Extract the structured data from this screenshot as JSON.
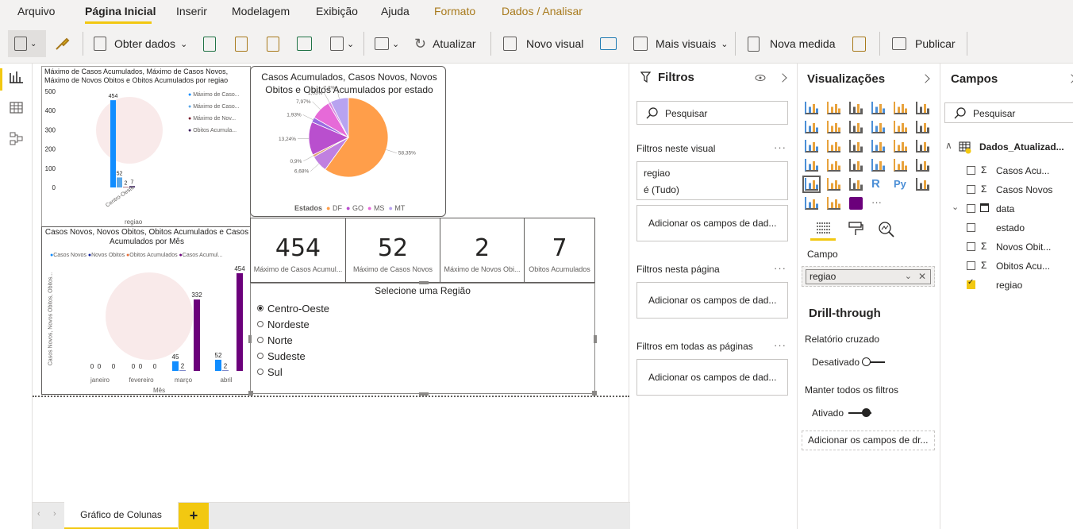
{
  "ribbon": {
    "tabs": [
      "Arquivo",
      "Página Inicial",
      "Inserir",
      "Modelagem",
      "Exibição",
      "Ajuda",
      "Formato",
      "Dados / Analisar"
    ]
  },
  "toolbar": {
    "obter": "Obter dados",
    "atualizar": "Atualizar",
    "novo_visual": "Novo visual",
    "mais_visuais": "Mais visuais",
    "nova_medida": "Nova medida",
    "publicar": "Publicar"
  },
  "colors": {
    "accent": "#f2c811",
    "bar_blue": "#118dff",
    "bar_dark": "#12239e",
    "bar_orange": "#e66c37",
    "bar_purple": "#6b007b",
    "pie_orange": "#ff9e4a",
    "pie_purple": "#b94fce",
    "pie_pink": "#e66ad8",
    "pie_lav": "#b8a3f0"
  },
  "visual1": {
    "title": "Máximo de Casos Acumulados, Máximo de Casos Novos, Máximo de Novos Obitos e Obitos Acumulados por regiao",
    "legend": [
      "Máximo de Caso...",
      "Máximo de Caso...",
      "Máximo de Nov...",
      "Obitos Acumula..."
    ],
    "xlabel": "regiao"
  },
  "visual2": {
    "title": "Casos Acumulados, Casos Novos, Novos Obitos e Obitos Acumulados por estado",
    "legend_title": "Estados",
    "legend": [
      "DF",
      "GO",
      "MS",
      "MT"
    ]
  },
  "visual3": {
    "title": "Casos Novos, Novos Obitos, Obitos Acumulados e Casos Acumulados por Mês",
    "legend": [
      "Casos Novos",
      "Novos Obitos",
      "Obitos Acumulados",
      "Casos Acumul..."
    ],
    "ylabel": "Casos Novos, Novos Obitos, Obitos...",
    "xlabel": "Mês"
  },
  "chart_data": [
    {
      "type": "bar",
      "title": "Máximo de Casos Acumulados, Máximo de Casos Novos, Máximo de Novos Obitos e Obitos Acumulados por regiao",
      "categories": [
        "Centro-Oeste"
      ],
      "series": [
        {
          "name": "Máximo de Caso...",
          "values": [
            454
          ]
        },
        {
          "name": "Máximo de Caso...",
          "values": [
            52
          ]
        },
        {
          "name": "Máximo de Nov...",
          "values": [
            2
          ]
        },
        {
          "name": "Obitos Acumula...",
          "values": [
            7
          ]
        }
      ],
      "yticks": [
        "0",
        "100",
        "200",
        "300",
        "400",
        "500"
      ],
      "ylim": [
        0,
        500
      ],
      "xlabel": "regiao",
      "legend": "right"
    },
    {
      "type": "pie",
      "title": "Casos Acumulados, Casos Novos, Novos Obitos e Obitos Acumulados por estado",
      "slices": [
        {
          "label": "58,35%",
          "value": 58.35
        },
        {
          "label": "6,68%",
          "value": 6.68
        },
        {
          "label": "0,9%",
          "value": 0.9
        },
        {
          "label": "13,24%",
          "value": 13.24
        },
        {
          "label": "1,93%",
          "value": 1.93
        },
        {
          "label": "7,97%",
          "value": 7.97
        },
        {
          "label": "1,03%",
          "value": 1.03
        },
        {
          "label": "7,2%",
          "value": 7.2
        }
      ],
      "legend": "bottom"
    },
    {
      "type": "bar",
      "title": "Casos Novos, Novos Obitos, Obitos Acumulados e Casos Acumulados por Mês",
      "categories": [
        "janeiro",
        "fevereiro",
        "março",
        "abril"
      ],
      "series": [
        {
          "name": "Casos Novos",
          "values": [
            0,
            0,
            45,
            52
          ]
        },
        {
          "name": "Novos Obitos",
          "values": [
            0,
            0,
            2,
            2
          ]
        },
        {
          "name": "Obitos Acumulados",
          "values": [
            0,
            0,
            0,
            0
          ]
        },
        {
          "name": "Casos Acumul...",
          "values": [
            0,
            0,
            332,
            454
          ]
        }
      ],
      "xlabel": "Mês",
      "ylabel": "Casos Novos, Novos Obitos, Obitos...",
      "legend": "top"
    }
  ],
  "cards": [
    {
      "value": "454",
      "label": "Máximo de Casos Acumul..."
    },
    {
      "value": "52",
      "label": "Máximo de Casos Novos"
    },
    {
      "value": "2",
      "label": "Máximo de Novos Obi..."
    },
    {
      "value": "7",
      "label": "Obitos Acumulados"
    }
  ],
  "slicer": {
    "title": "Selecione uma Região",
    "options": [
      "Centro-Oeste",
      "Nordeste",
      "Norte",
      "Sudeste",
      "Sul"
    ],
    "selected": "Centro-Oeste"
  },
  "pages": {
    "tab": "Gráfico de Colunas",
    "add": "+"
  },
  "filters": {
    "title": "Filtros",
    "search": "Pesquisar",
    "visual_section": "Filtros neste visual",
    "card_field": "regiao",
    "card_value": "é (Tudo)",
    "add": "Adicionar os campos de dad...",
    "page_section": "Filtros nesta página",
    "all_section": "Filtros em todas as páginas"
  },
  "viz": {
    "title": "Visualizações",
    "campo": "Campo",
    "campo_value": "regiao",
    "drill": "Drill-through",
    "cruzado": "Relatório cruzado",
    "desativado": "Desativado",
    "manter": "Manter todos os filtros",
    "ativado": "Ativado",
    "add": "Adicionar os campos de dr...",
    "more": "···"
  },
  "campos": {
    "title": "Campos",
    "search": "Pesquisar",
    "table": "Dados_Atualizad...",
    "fields": [
      "Casos Acu...",
      "Casos Novos",
      "data",
      "estado",
      "Novos Obit...",
      "Obitos Acu...",
      "regiao"
    ]
  }
}
